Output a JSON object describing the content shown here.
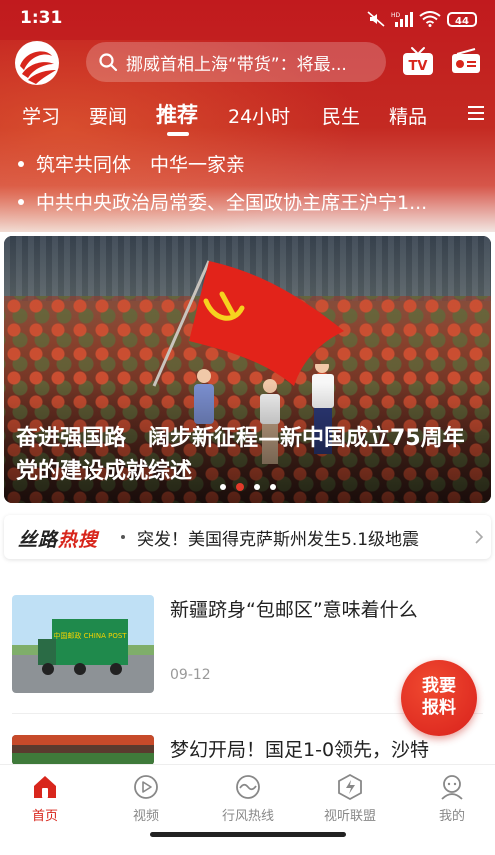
{
  "status": {
    "time": "1:31",
    "battery": "44"
  },
  "search": {
    "placeholder": "挪威首相上海“带货”：将最..."
  },
  "nav": {
    "tabs": [
      "学习",
      "要闻",
      "推荐",
      "24小时",
      "民生",
      "精品"
    ],
    "active": "推荐"
  },
  "headlines": [
    "筑牢共同体　中华一家亲",
    "中共中央政治局常委、全国政协主席王沪宁1..."
  ],
  "banner": {
    "caption": "奋进强国路　阔步新征程—新中国成立75周年党的建设成就综述",
    "pages": 4,
    "current_page": 2
  },
  "hot": {
    "brand_a": "丝路",
    "brand_b": "热搜",
    "text": "突发！美国得克萨斯州发生5.1级地震"
  },
  "news": [
    {
      "title": "新疆跻身“包邮区”意味着什么",
      "date": "09-12",
      "truck_label": "中国邮政 CHINA POST"
    },
    {
      "title": "梦幻开局！国足1-0领先，沙特",
      "date": ""
    }
  ],
  "float_button": {
    "line1": "我要",
    "line2": "报料"
  },
  "tabbar": {
    "items": [
      "首页",
      "视频",
      "行风热线",
      "视听联盟",
      "我的"
    ],
    "active": "首页"
  },
  "colors": {
    "brand_red": "#d8261c",
    "header_red": "#c11a1e"
  },
  "icons": [
    "logo-icon",
    "search-icon",
    "tv-icon",
    "radio-icon",
    "menu-icon",
    "chevron-right-icon",
    "home-icon",
    "video-icon",
    "hotline-icon",
    "alliance-icon",
    "profile-icon"
  ]
}
